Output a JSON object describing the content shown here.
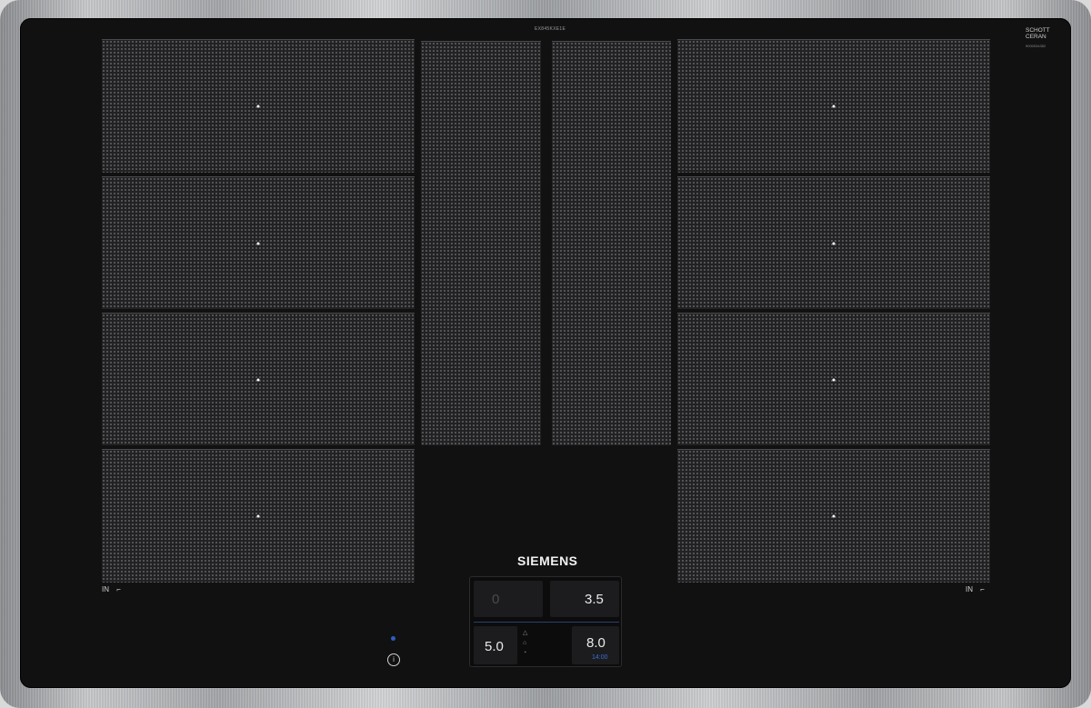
{
  "model_code": "EX845KXE1E",
  "brand": "SIEMENS",
  "ceramic_brand": {
    "line1": "SCHOTT",
    "line2": "CERAN"
  },
  "serial_small": "9000934352",
  "zone_labels": {
    "left": "IN",
    "right": "IN"
  },
  "control_panel": {
    "top_left": {
      "value": "0"
    },
    "top_right": {
      "value": "3.5"
    },
    "bottom_left": {
      "value": "5.0"
    },
    "bottom_right": {
      "value": "8.0",
      "timer": "14:00"
    }
  },
  "info_icon": "info-icon",
  "colors": {
    "glass": "#121112",
    "accent_blue": "#2f5cc0"
  }
}
